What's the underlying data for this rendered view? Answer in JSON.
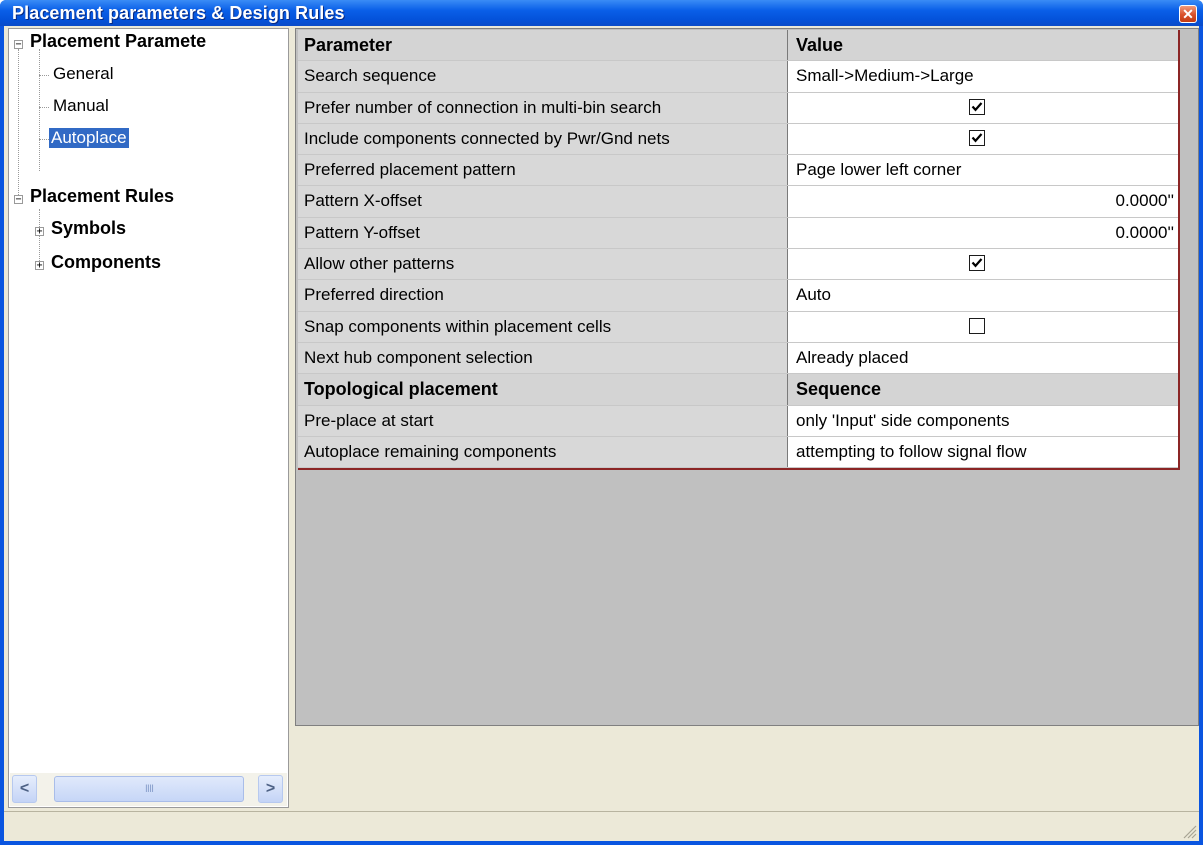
{
  "window": {
    "title": "Placement parameters & Design Rules",
    "close_label": "✕"
  },
  "tree": {
    "placement_parameters": {
      "label": "Placement Paramete",
      "children": [
        "General",
        "Manual",
        "Autoplace"
      ],
      "selected": "Autoplace"
    },
    "placement_rules": {
      "label": "Placement Rules",
      "children": [
        "Symbols",
        "Components"
      ]
    }
  },
  "scrollbar": {
    "left_arrow": "<",
    "right_arrow": ">",
    "thumb_grip": "IIII"
  },
  "grid": {
    "header": {
      "parameter": "Parameter",
      "value": "Value"
    },
    "rows": [
      {
        "parameter": "Search sequence",
        "value": "Small->Medium->Large"
      },
      {
        "parameter": "Prefer number of connection in multi-bin search",
        "checked": true
      },
      {
        "parameter": "Include components connected by Pwr/Gnd nets",
        "checked": true
      },
      {
        "parameter": "Preferred placement pattern",
        "value": "Page lower left corner"
      },
      {
        "parameter": "Pattern X-offset",
        "value": "0.0000''"
      },
      {
        "parameter": "Pattern Y-offset",
        "value": "0.0000''"
      },
      {
        "parameter": "Allow other patterns",
        "checked": true
      },
      {
        "parameter": "Preferred direction",
        "value": "Auto"
      },
      {
        "parameter": "Snap components within placement cells",
        "checked": false
      },
      {
        "parameter": "Next hub component selection",
        "value": "Already placed"
      }
    ],
    "section": {
      "parameter": "Topological placement",
      "value": "Sequence"
    },
    "section_rows": [
      {
        "parameter": "Pre-place at start",
        "value": "only 'Input' side components"
      },
      {
        "parameter": "Autoplace remaining components",
        "value": "attempting to follow signal flow"
      }
    ]
  },
  "colors": {
    "titlebar": "#0a5fe8",
    "selection": "#316ac5",
    "grid_border": "#8b2525",
    "dialog_bg": "#ece9d8"
  }
}
